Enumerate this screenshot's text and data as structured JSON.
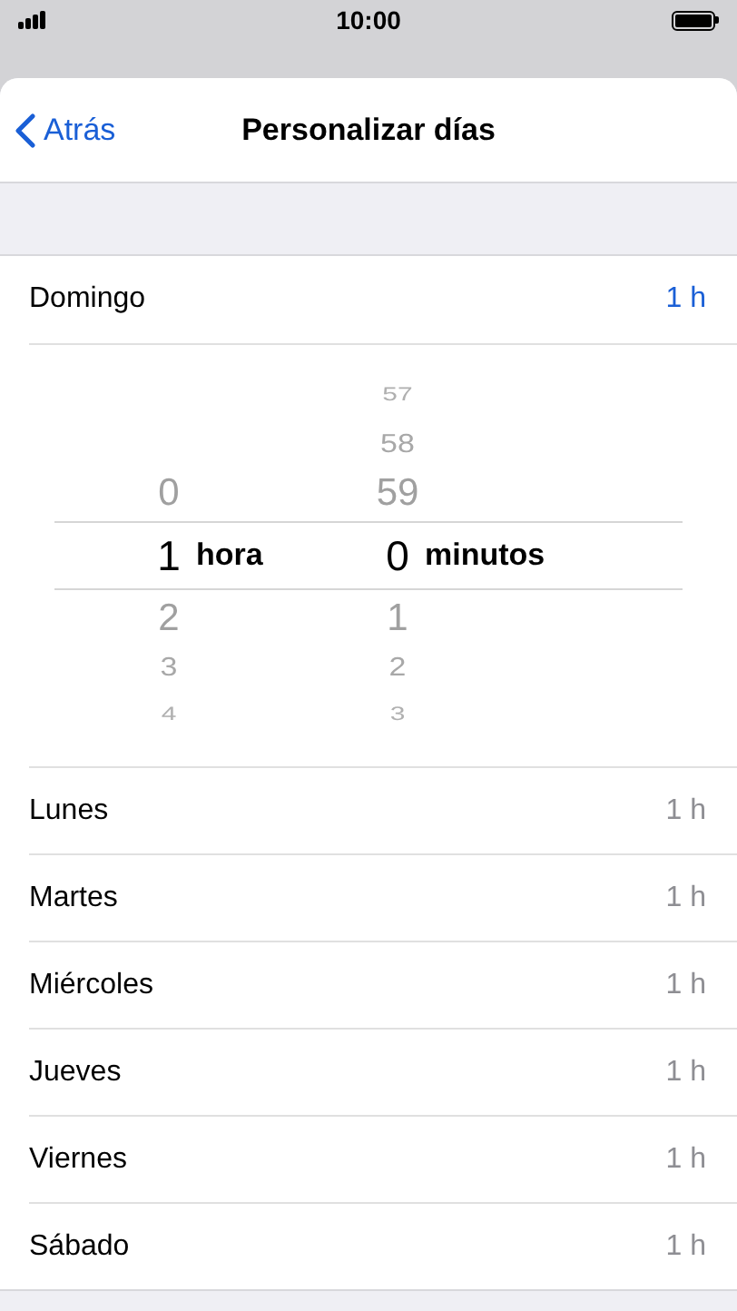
{
  "status_bar": {
    "time": "10:00"
  },
  "nav": {
    "back": "Atrás",
    "title": "Personalizar días"
  },
  "selected_day": {
    "label": "Domingo",
    "value": "1 h"
  },
  "picker": {
    "hours": {
      "above": [
        "0"
      ],
      "value": "1",
      "unit": "hora",
      "below": [
        "2",
        "3",
        "4"
      ]
    },
    "minutes": {
      "above": [
        "57",
        "58",
        "59"
      ],
      "value": "0",
      "unit": "minutos",
      "below": [
        "1",
        "2",
        "3"
      ]
    }
  },
  "days": [
    {
      "label": "Lunes",
      "value": "1 h"
    },
    {
      "label": "Martes",
      "value": "1 h"
    },
    {
      "label": "Miércoles",
      "value": "1 h"
    },
    {
      "label": "Jueves",
      "value": "1 h"
    },
    {
      "label": "Viernes",
      "value": "1 h"
    },
    {
      "label": "Sábado",
      "value": "1 h"
    }
  ]
}
